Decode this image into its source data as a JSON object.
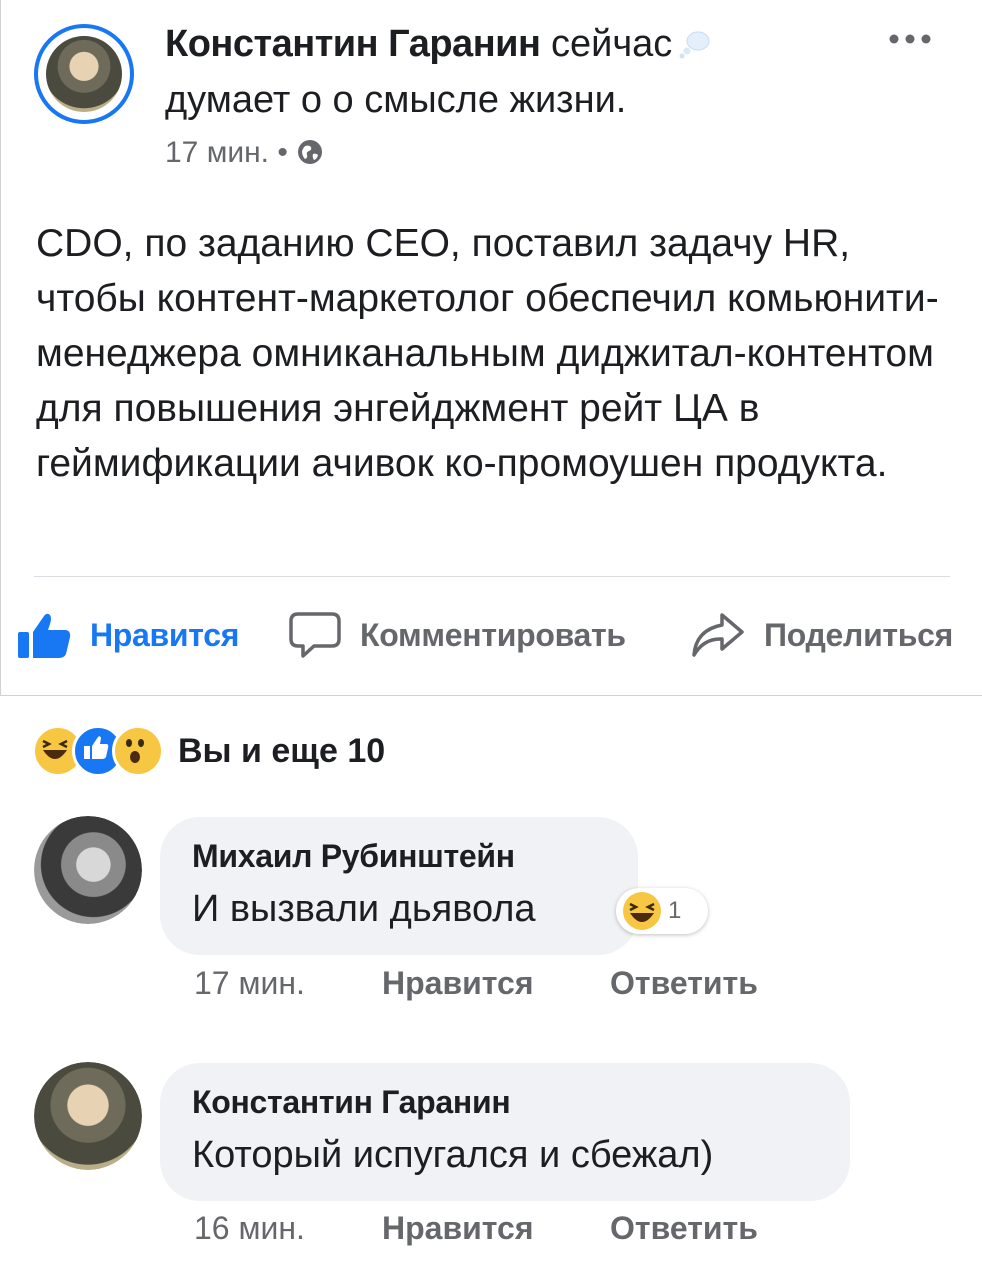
{
  "post": {
    "author": "Константин Гаранин",
    "status_word": "сейчас",
    "status_rest": "думает о о смысле жизни.",
    "time": "17 мин.",
    "separator": "•",
    "body": "CDO, по заданию CEO, поставил задачу HR, чтобы контент-маркетолог обеспечил комьюнити-менеджера омниканальным диджитал-контентом для повышения энгейджмент рейт ЦА в геймификации ачивок ко-промоушен продукта."
  },
  "actions": {
    "like": "Нравится",
    "comment": "Комментировать",
    "share": "Поделиться"
  },
  "reactions": {
    "summary": "Вы и еще 10",
    "types": [
      "haha-icon",
      "like-icon",
      "wow-icon"
    ]
  },
  "comments": [
    {
      "author": "Михаил Рубинштейн",
      "text": "И вызвали дьявола",
      "time": "17 мин.",
      "like": "Нравится",
      "reply": "Ответить",
      "reaction_count": "1"
    },
    {
      "author": "Константин Гаранин",
      "text": "Который испугался и сбежал)",
      "time": "16 мин.",
      "like": "Нравится",
      "reply": "Ответить"
    }
  ],
  "colors": {
    "accent": "#1877f2",
    "muted": "#65676b",
    "bubble": "#f0f2f5"
  }
}
